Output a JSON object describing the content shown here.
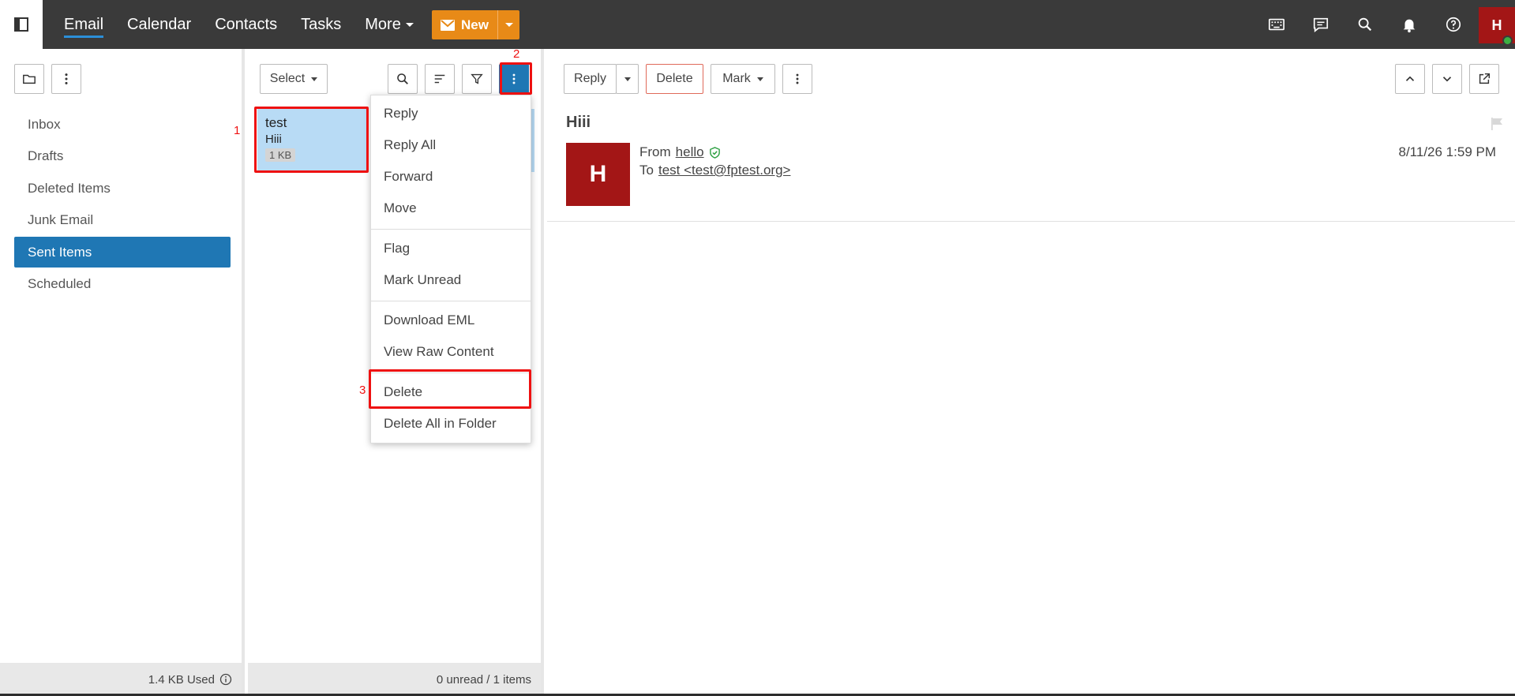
{
  "nav": {
    "items": [
      "Email",
      "Calendar",
      "Contacts",
      "Tasks"
    ],
    "more_label": "More",
    "new_label": "New",
    "avatar_initial": "H"
  },
  "folders": {
    "items": [
      "Inbox",
      "Drafts",
      "Deleted Items",
      "Junk Email",
      "Sent Items",
      "Scheduled"
    ],
    "active": "Sent Items",
    "storage": "1.4 KB Used"
  },
  "list": {
    "select_label": "Select",
    "message": {
      "from": "test",
      "subject": "Hiii",
      "size": "1 KB"
    },
    "count": "0 unread / 1 items"
  },
  "menu": {
    "items": [
      "Reply",
      "Reply All",
      "Forward",
      "Move",
      "Flag",
      "Mark Unread",
      "Download EML",
      "View Raw Content",
      "Delete",
      "Delete All in Folder"
    ]
  },
  "reading": {
    "reply_label": "Reply",
    "delete_label": "Delete",
    "mark_label": "Mark",
    "subject": "Hiii",
    "avatar_initial": "H",
    "from_label": "From",
    "from_name": "hello",
    "to_label": "To",
    "to_address": "test <test@fptest.org>",
    "date": "8/11/26 1:59 PM"
  },
  "annotations": [
    "1",
    "2",
    "3"
  ],
  "colors": {
    "accent": "#1f77b4",
    "new_button": "#e88a17",
    "avatar": "#a31616",
    "annotation": "#ee1111"
  }
}
